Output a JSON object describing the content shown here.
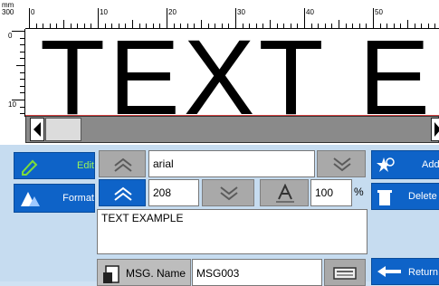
{
  "ruler": {
    "unit_top": "mm",
    "unit_bottom": "300",
    "h_labels": [
      "0",
      "10",
      "20",
      "30",
      "40",
      "50"
    ],
    "v_labels": [
      "0",
      "10"
    ]
  },
  "canvas": {
    "text": "TEXT E"
  },
  "left_tools": {
    "edit_label": "Edit",
    "format_label": "Format"
  },
  "font": {
    "name": "arial"
  },
  "size": {
    "value": "208",
    "scale_value": "100",
    "scale_unit": "%"
  },
  "message": {
    "text": "TEXT EXAMPLE",
    "name_label": "MSG. Name",
    "name_value": "MSG003"
  },
  "right_tools": {
    "add_label": "Add",
    "delete_label": "Delete",
    "return_label": "Return"
  },
  "colors": {
    "accent_blue": "#0e63c8",
    "edit_green": "#2e8b2e",
    "panel_bg": "#c6dcf0"
  }
}
